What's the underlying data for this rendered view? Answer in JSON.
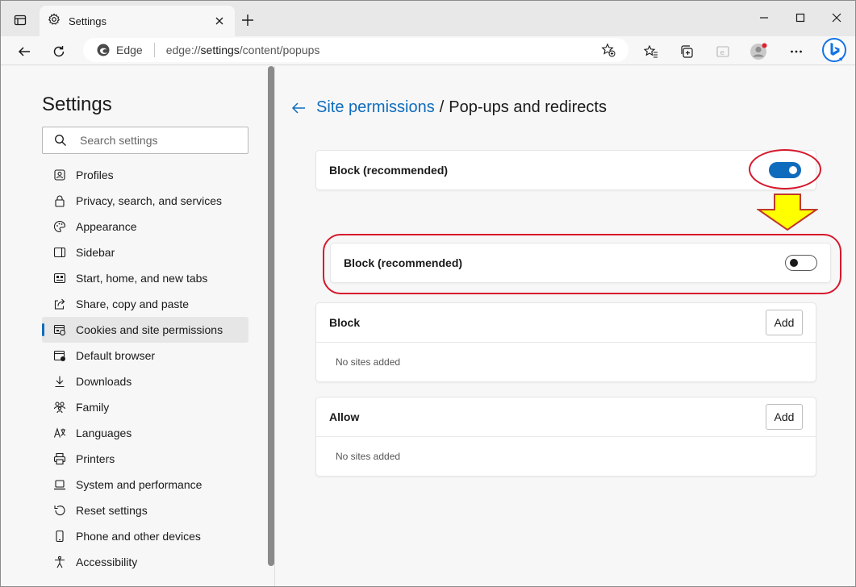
{
  "browser": {
    "tab": {
      "title": "Settings"
    },
    "address": {
      "site_name": "Edge",
      "url_prefix": "edge://",
      "url_main": "settings",
      "url_rest": "/content/popups"
    }
  },
  "sidebar": {
    "title": "Settings",
    "search_placeholder": "Search settings",
    "items": [
      {
        "label": "Profiles",
        "icon": "profile-icon"
      },
      {
        "label": "Privacy, search, and services",
        "icon": "lock-icon"
      },
      {
        "label": "Appearance",
        "icon": "palette-icon"
      },
      {
        "label": "Sidebar",
        "icon": "sidebar-icon"
      },
      {
        "label": "Start, home, and new tabs",
        "icon": "home-tabs-icon"
      },
      {
        "label": "Share, copy and paste",
        "icon": "share-icon"
      },
      {
        "label": "Cookies and site permissions",
        "icon": "cookies-icon",
        "active": true
      },
      {
        "label": "Default browser",
        "icon": "browser-icon"
      },
      {
        "label": "Downloads",
        "icon": "download-icon"
      },
      {
        "label": "Family",
        "icon": "family-icon"
      },
      {
        "label": "Languages",
        "icon": "languages-icon"
      },
      {
        "label": "Printers",
        "icon": "printer-icon"
      },
      {
        "label": "System and performance",
        "icon": "laptop-icon"
      },
      {
        "label": "Reset settings",
        "icon": "reset-icon"
      },
      {
        "label": "Phone and other devices",
        "icon": "phone-icon"
      },
      {
        "label": "Accessibility",
        "icon": "accessibility-icon"
      }
    ]
  },
  "main": {
    "breadcrumb_parent": "Site permissions",
    "breadcrumb_separator": "/",
    "breadcrumb_current": "Pop-ups and redirects",
    "block_recommended_label": "Block (recommended)",
    "block_recommended_on": true,
    "block_recommended_after_label": "Block (recommended)",
    "block_recommended_after_on": false,
    "block_section": {
      "title": "Block",
      "button": "Add",
      "empty": "No sites added"
    },
    "allow_section": {
      "title": "Allow",
      "button": "Add",
      "empty": "No sites added"
    }
  },
  "colors": {
    "accent": "#0f6cbd",
    "annotation": "#d6182b",
    "arrow_fill": "#ffff00"
  }
}
